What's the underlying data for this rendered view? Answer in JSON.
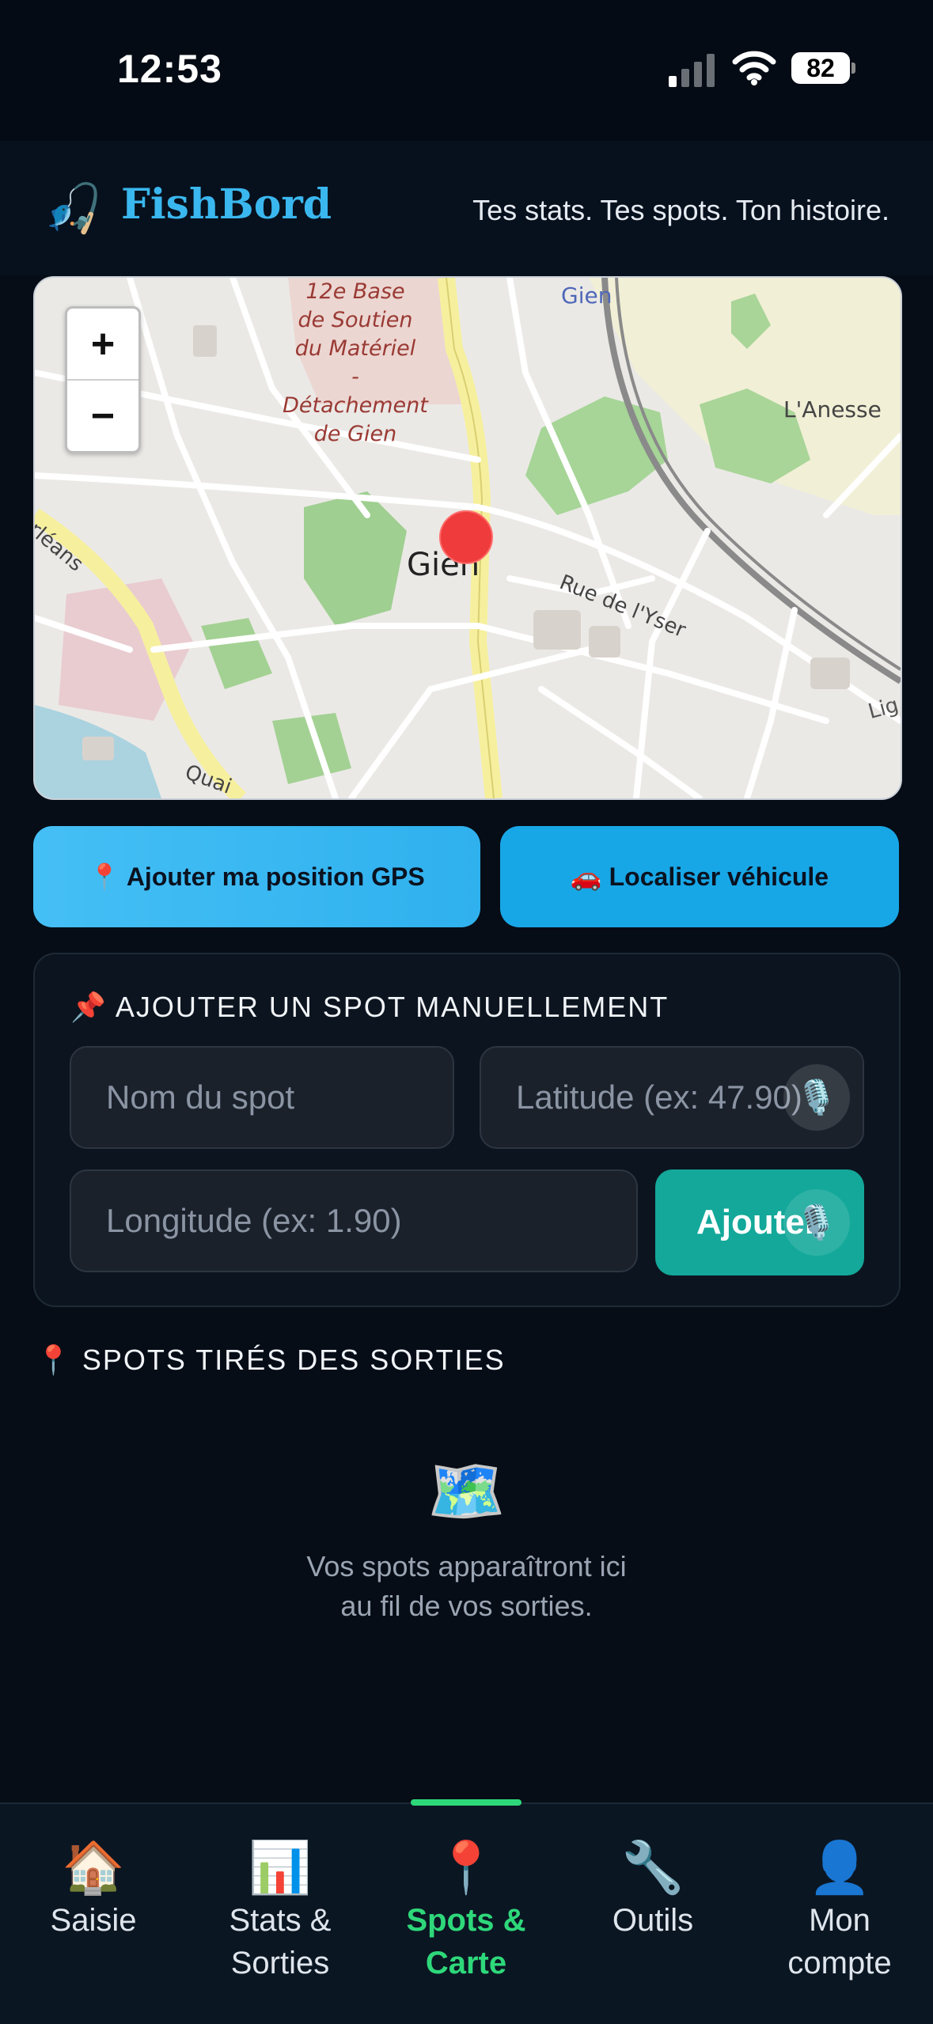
{
  "status_bar": {
    "time": "12:53",
    "battery": "82"
  },
  "header": {
    "icon": "🎣",
    "app_name": "FishBord",
    "tagline": "Tes stats. Tes spots. Ton histoire."
  },
  "map": {
    "zoom_in": "+",
    "zoom_out": "−",
    "labels": {
      "poi": [
        "12e Base",
        "de Soutien",
        "du Matériel",
        "- Détachement",
        "de Gien"
      ],
      "gien_top": "Gien",
      "town": "Gien",
      "lanesse": "L'Anesse",
      "rue_yser": "Rue de l'Yser",
      "orleans": "Orléans",
      "quai": "Quai",
      "lig": "Lig"
    }
  },
  "actions": {
    "gps_button": "📍 Ajouter ma position GPS",
    "vehicle_button": "🚗 Localiser véhicule"
  },
  "manual_spot": {
    "title": "📌 AJOUTER UN SPOT MANUELLEMENT",
    "name_placeholder": "Nom du spot",
    "lat_placeholder": "Latitude (ex: 47.90)",
    "lon_placeholder": "Longitude (ex: 1.90)",
    "add_label": "Ajouter",
    "mic_icon": "🎙️"
  },
  "spots_section": {
    "title": "📍 SPOTS TIRÉS DES SORTIES",
    "empty_icon": "🗺️",
    "empty_line1": "Vos spots apparaîtront ici",
    "empty_line2": "au fil de vos sorties."
  },
  "nav": {
    "items": [
      {
        "icon": "🏠",
        "line1": "Saisie",
        "line2": ""
      },
      {
        "icon": "📊",
        "line1": "Stats &",
        "line2": "Sorties"
      },
      {
        "icon": "📍",
        "line1": "Spots &",
        "line2": "Carte"
      },
      {
        "icon": "🔧",
        "line1": "Outils",
        "line2": ""
      },
      {
        "icon": "👤",
        "line1": "Mon",
        "line2": "compte"
      }
    ]
  }
}
